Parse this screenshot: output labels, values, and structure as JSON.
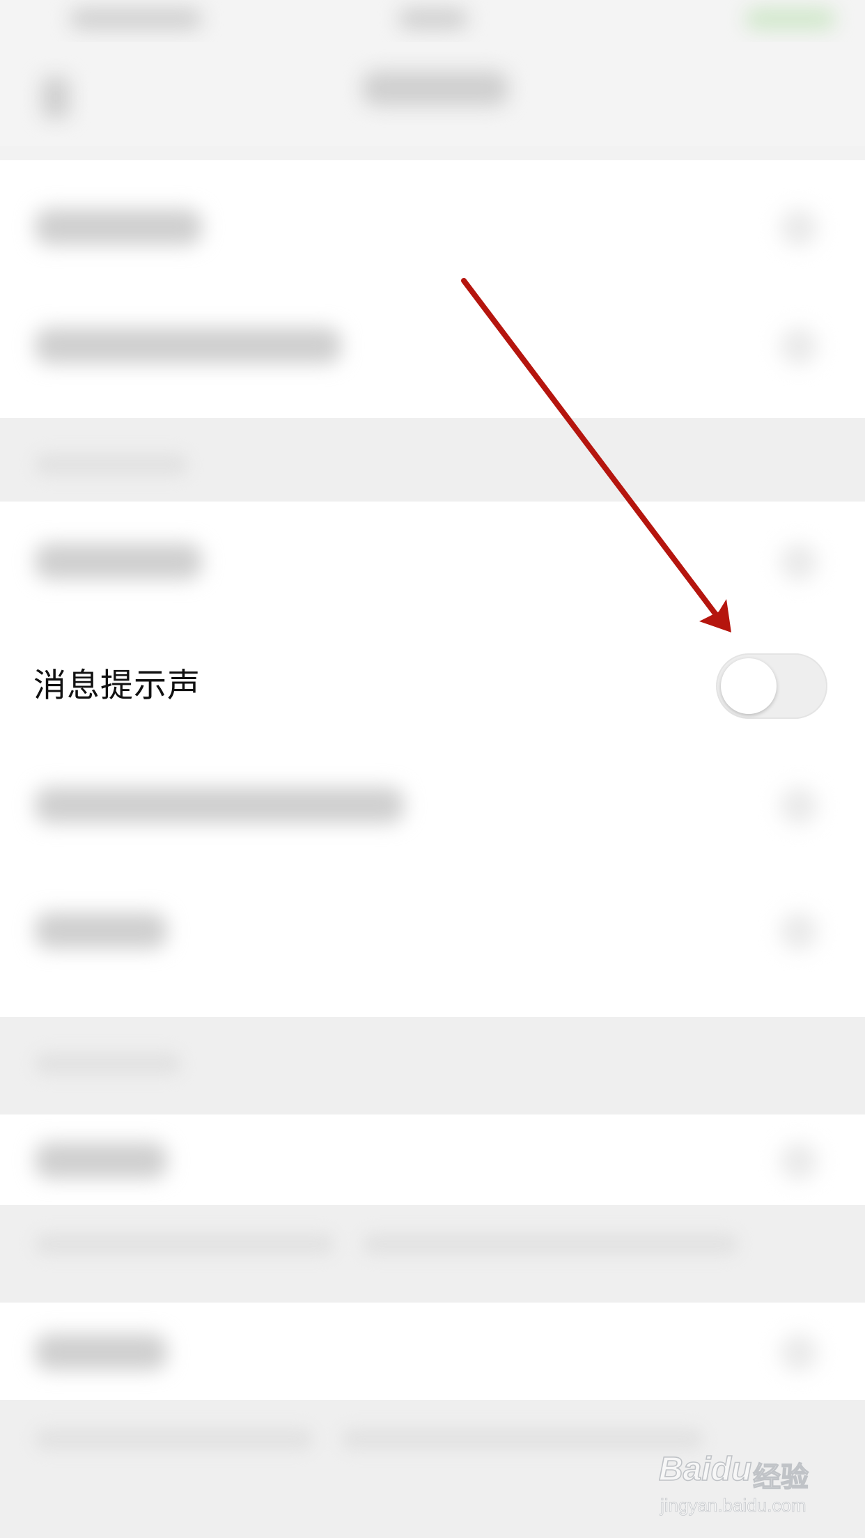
{
  "setting": {
    "label": "消息提示声",
    "toggle_state": "off"
  },
  "watermark": {
    "logo": "Baidu",
    "cn": "经验",
    "url": "jingyan.baidu.com"
  },
  "colors": {
    "arrow": "#b5150e",
    "toggle_track_off": "#eeeeee",
    "background": "#f2f2f2",
    "cell": "#ffffff"
  }
}
